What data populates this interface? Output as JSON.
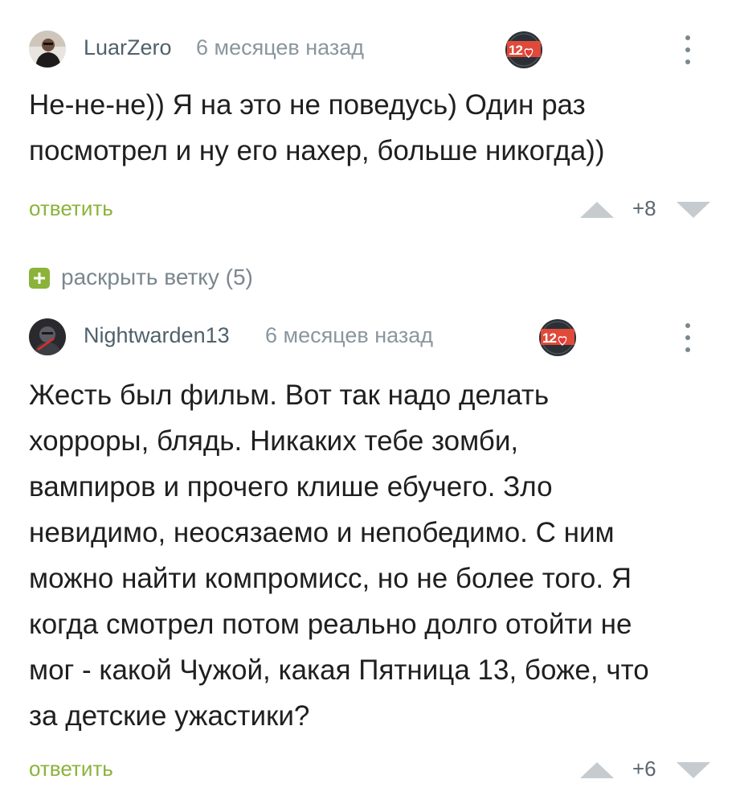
{
  "comments": [
    {
      "username": "LuarZero",
      "time": "6 месяцев назад",
      "text_lines": [
        "Не-не-не)) Я на это не поведусь) Один раз",
        "посмотрел и ну его нахер, больше никогда))"
      ],
      "reply_label": "ответить",
      "rating": "+8",
      "badge_icon": "award-1280-heart-icon"
    },
    {
      "username": "Nightwarden13",
      "time": "6 месяцев назад",
      "text_lines": [
        "Жесть был фильм. Вот так надо делать",
        "хорроры, блядь. Никаких тебе зомби,",
        "вампиров и прочего клише ебучего. Зло",
        "невидимо, неосязаемо и непобедимо. С ним",
        "можно найти компромисс, но не более того. Я",
        "когда смотрел потом реально долго отойти не",
        "мог - какой Чужой, какая Пятница 13, боже, что",
        "за детские ужастики?"
      ],
      "reply_label": "ответить",
      "rating": "+6",
      "badge_icon": "award-1280-heart-icon"
    }
  ],
  "expand_thread": {
    "label": "раскрыть ветку (5)",
    "icon": "plus-square-icon"
  },
  "colors": {
    "accent_green": "#8bb33a",
    "badge_red": "#e53935",
    "badge_dark": "#2b3036"
  }
}
